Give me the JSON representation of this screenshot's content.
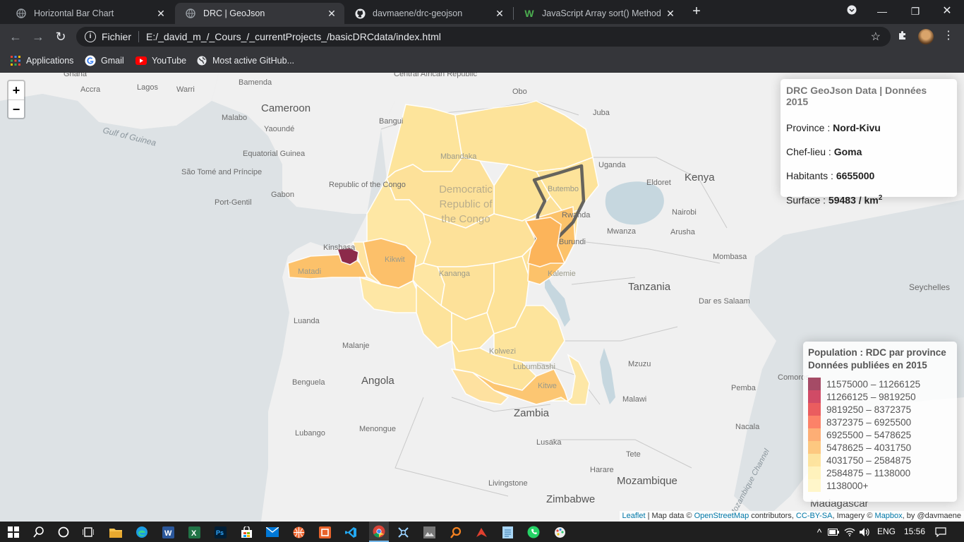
{
  "browser": {
    "tabs": [
      {
        "title": "Horizontal Bar Chart",
        "icon": "globe-icon",
        "active": false
      },
      {
        "title": "DRC | GeoJson",
        "icon": "globe-icon",
        "active": true
      },
      {
        "title": "davmaene/drc-geojson",
        "icon": "github-icon",
        "active": false
      },
      {
        "title": "JavaScript Array sort() Method",
        "icon": "w3schools-icon",
        "active": false
      }
    ],
    "new_tab": "+",
    "address": {
      "scheme": "Fichier",
      "url": "E:/_david_m_/_Cours_/_currentProjects_/basicDRCdata/index.html"
    },
    "bookmarks": [
      {
        "label": "Applications",
        "icon": "apps-grid-icon"
      },
      {
        "label": "Gmail",
        "icon": "google-icon"
      },
      {
        "label": "YouTube",
        "icon": "youtube-icon"
      },
      {
        "label": "Most active GitHub...",
        "icon": "globe-icon"
      }
    ]
  },
  "map": {
    "zoom_in": "+",
    "zoom_out": "−",
    "labels": {
      "ghana": "Ghana",
      "accra": "Accra",
      "lagos": "Lagos",
      "warri": "Warri",
      "bamenda": "Bamenda",
      "car": "Central African Republic",
      "obo": "Obo",
      "cameroon": "Cameroon",
      "malabo": "Malabo",
      "yaounde": "Yaoundé",
      "gulf": "Gulf of Guinea",
      "eq_guinea": "Equatorial Guinea",
      "sao_tome": "São Tomé and Príncipe",
      "gabon": "Gabon",
      "port_gentil": "Port-Gentil",
      "rep_congo": "Republic of the Congo",
      "drc": "Democratic Republic of the Congo",
      "bangui": "Bangui",
      "juba": "Juba",
      "uganda": "Uganda",
      "kenya": "Kenya",
      "eldoret": "Eldoret",
      "nairobi": "Nairobi",
      "mwanza": "Mwanza",
      "arusha": "Arusha",
      "mombasa": "Mombasa",
      "tanzania": "Tanzania",
      "seychelles": "Seychelles",
      "dar": "Dar es Salaam",
      "kinshasa": "Kinshasa",
      "matadi": "Matadi",
      "kikwit": "Kikwit",
      "kananga": "Kananga",
      "kalemie": "Kalemie",
      "burundi": "Burundi",
      "rwanda": "Rwanda",
      "butembo": "Butembo",
      "mbandaka": "Mbandaka",
      "luanda": "Luanda",
      "malanje": "Malanje",
      "angola": "Angola",
      "benguela": "Benguela",
      "kolwezi": "Kolwezi",
      "lubumbashi": "Lubumbashi",
      "kitwe": "Kitwe",
      "zambia": "Zambia",
      "lubango": "Lubango",
      "menongue": "Menongue",
      "lusaka": "Lusaka",
      "livingstone": "Livingstone",
      "zimbabwe": "Zimbabwe",
      "harare": "Harare",
      "tete": "Tete",
      "mozambique": "Mozambique",
      "malawi": "Malawi",
      "mzuzu": "Mzuzu",
      "pemba": "Pemba",
      "nacala": "Nacala",
      "comoros": "Comoros",
      "madagascar": "Madagascar",
      "moz_channel": "Mozambique Channel"
    }
  },
  "info": {
    "title": "DRC GeoJson Data | Données 2015",
    "province_label": "Province : ",
    "province": "Nord-Kivu",
    "capital_label": "Chef-lieu : ",
    "capital": "Goma",
    "population_label": "Habitants : ",
    "population": "6655000",
    "area_label": "Surface : ",
    "area": "59483 / km",
    "area_sup": "2"
  },
  "legend": {
    "title_line1": "Population : RDC par province",
    "title_line2": "Données publiées en 2015",
    "items": [
      {
        "range": "11575000  –  11266125",
        "color": "#800026"
      },
      {
        "range": "11266125  –  9819250",
        "color": "#BD0026"
      },
      {
        "range": "9819250  –  8372375",
        "color": "#E31A1C"
      },
      {
        "range": "8372375  –  6925500",
        "color": "#FC4E2A"
      },
      {
        "range": "6925500  –  5478625",
        "color": "#FD8D3C"
      },
      {
        "range": "5478625  –  4031750",
        "color": "#FEB24C"
      },
      {
        "range": "4031750  –  2584875",
        "color": "#FED976"
      },
      {
        "range": "2584875  –  1138000",
        "color": "#FFEDA0"
      },
      {
        "range": "1138000+",
        "color": "#FFF2B3"
      }
    ]
  },
  "attribution": {
    "leaflet": "Leaflet",
    "sep": " | Map data © ",
    "osm": "OpenStreetMap",
    "contrib": " contributors, ",
    "cc": "CC-BY-SA",
    "imagery": ", Imagery © ",
    "mapbox": "Mapbox",
    "by": ", by @davmaene"
  },
  "taskbar": {
    "lang": "ENG",
    "time": "15:56"
  }
}
